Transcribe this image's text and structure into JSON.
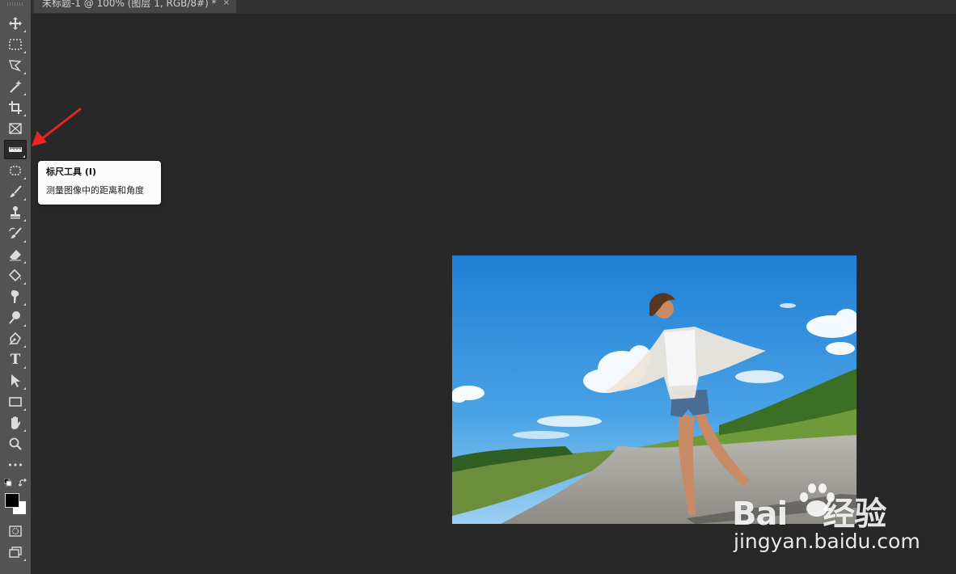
{
  "document_tab": {
    "title": "未标题-1 @ 100% (图层 1, RGB/8#) *",
    "close_glyph": "×"
  },
  "tooltip": {
    "title": "标尺工具 (I)",
    "description": "测量图像中的距离和角度"
  },
  "toolbar": {
    "tools": [
      "move-tool",
      "marquee-tool",
      "lasso-tool",
      "magic-wand-tool",
      "crop-tool",
      "frame-tool",
      "ruler-tool",
      "patch-tool",
      "brush-tool",
      "stamp-tool",
      "history-brush-tool",
      "eraser-tool",
      "paint-bucket-tool",
      "smudge-tool",
      "dodge-tool",
      "pen-tool",
      "type-tool",
      "path-select-tool",
      "rectangle-tool",
      "hand-tool",
      "zoom-tool",
      "more-tools",
      "quick-mask-mode",
      "screen-mode"
    ],
    "active_tool": "ruler-tool",
    "type_tool_glyph": "T",
    "more_tools_glyph": "•••"
  },
  "colors": {
    "foreground": "#000000",
    "background": "#ffffff",
    "annotation_arrow": "#e8261f"
  },
  "watermark": {
    "logo_text_left": "Bai",
    "logo_text_right": "经验",
    "url": "jingyan.baidu.com"
  }
}
